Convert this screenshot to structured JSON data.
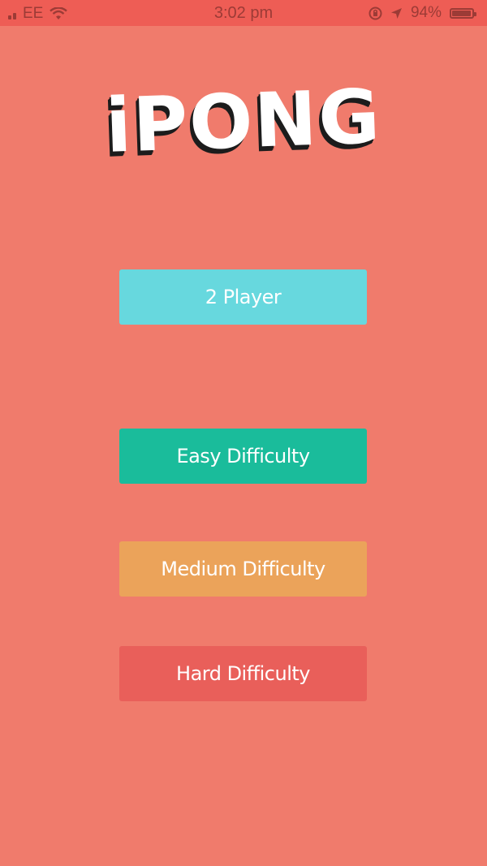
{
  "status_bar": {
    "carrier": "EE",
    "time": "3:02 pm",
    "battery_text": "94%",
    "battery_level": 0.94,
    "signal_bars": 2,
    "icons": [
      "signal-icon",
      "wifi-icon",
      "orientation-lock-icon",
      "location-icon",
      "battery-icon"
    ]
  },
  "app": {
    "title": "iPONG"
  },
  "menu": {
    "two_player": "2 Player",
    "easy": "Easy Difficulty",
    "medium": "Medium Difficulty",
    "hard": "Hard Difficulty"
  },
  "colors": {
    "background": "#f07b6c",
    "status_bar": "#ee5d55",
    "two_player": "#67d8de",
    "easy": "#1abc9b",
    "medium": "#eba35a",
    "hard": "#e95f5a"
  }
}
